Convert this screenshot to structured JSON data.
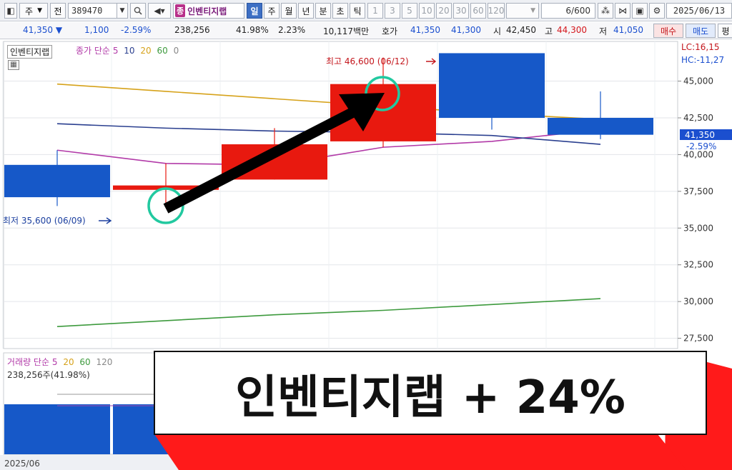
{
  "toolbar": {
    "market": "주",
    "scope": "전",
    "code": "389470",
    "badge": "종",
    "stock_name": "인벤티지랩",
    "periods": [
      "일",
      "주",
      "월",
      "년",
      "분",
      "초",
      "틱"
    ],
    "active_period": "일",
    "intervals": [
      "1",
      "3",
      "5",
      "10",
      "20",
      "30",
      "60",
      "120"
    ],
    "count": "6",
    "count_max": "/600",
    "date": "2025/06/13"
  },
  "quote": {
    "price": "41,350",
    "direction": "▼",
    "change": "1,100",
    "change_pct": "-2.59%",
    "volume": "238,256",
    "volume_ratio": "41.98%",
    "turnover": "2.23%",
    "amount": "10,117백만",
    "bid_label": "호가",
    "ask_price": "41,350",
    "bid_price": "41,300",
    "open_label": "시",
    "open": "42,450",
    "high_label": "고",
    "high": "44,300",
    "low_label": "저",
    "low": "41,050",
    "buy_label": "매수",
    "sell_label": "매도",
    "extra_label": "평"
  },
  "legend": {
    "name_tag": "인벤티지랩",
    "ma_label": "종가 단순",
    "ma_periods": [
      "5",
      "10",
      "20",
      "60",
      "0"
    ],
    "ma_colors": [
      "#b23aa8",
      "#2a3f8f",
      "#d6a21a",
      "#3d9a3d",
      "#888888"
    ]
  },
  "volume_legend": {
    "label": "거래량 단순",
    "periods": [
      "5",
      "20",
      "60",
      "120"
    ],
    "value": "238,256주(41.98%)"
  },
  "annotations": {
    "high": "최고 46,600 (06/12)",
    "low": "최저 35,600 (06/09)",
    "lc": "LC:16,15",
    "hc": "HC:-11,27",
    "current_price": "41,350",
    "current_pct": "-2.59%",
    "x_label": "2025/06"
  },
  "banner": {
    "text": "인벤티지랩 + 24%",
    "accent": "#ff1a1a"
  },
  "chart_data": {
    "type": "candlestick",
    "y_ticks": [
      "45,000",
      "42,500",
      "40,000",
      "37,500",
      "35,000",
      "32,500",
      "30,000",
      "27,500"
    ],
    "ylim": [
      26800,
      47700
    ],
    "candles": [
      {
        "open": 39300,
        "high": 40300,
        "low": 36500,
        "close": 37100
      },
      {
        "open": 37600,
        "high": 39400,
        "low": 36400,
        "close": 37900
      },
      {
        "open": 38300,
        "high": 41800,
        "low": 38300,
        "close": 40700
      },
      {
        "open": 40900,
        "high": 46600,
        "low": 40500,
        "close": 44800
      },
      {
        "open": 46900,
        "high": 46900,
        "low": 41700,
        "close": 42500
      },
      {
        "open": 42500,
        "high": 44300,
        "low": 41050,
        "close": 41350
      }
    ],
    "ma_lines": [
      {
        "period": "5",
        "color": "#b23aa8",
        "values": [
          40300,
          39400,
          39300,
          40500,
          40900,
          41700
        ]
      },
      {
        "period": "10",
        "color": "#2a3f8f",
        "values": [
          42100,
          41800,
          41600,
          41500,
          41300,
          40700
        ]
      },
      {
        "period": "20",
        "color": "#d6a21a",
        "values": [
          44800,
          44300,
          43800,
          43300,
          42800,
          42400
        ]
      },
      {
        "period": "60",
        "color": "#3d9a3d",
        "values": [
          28300,
          28700,
          29100,
          29400,
          29800,
          30200
        ]
      }
    ],
    "volume": [
      1,
      1,
      1,
      1,
      1,
      1
    ]
  }
}
